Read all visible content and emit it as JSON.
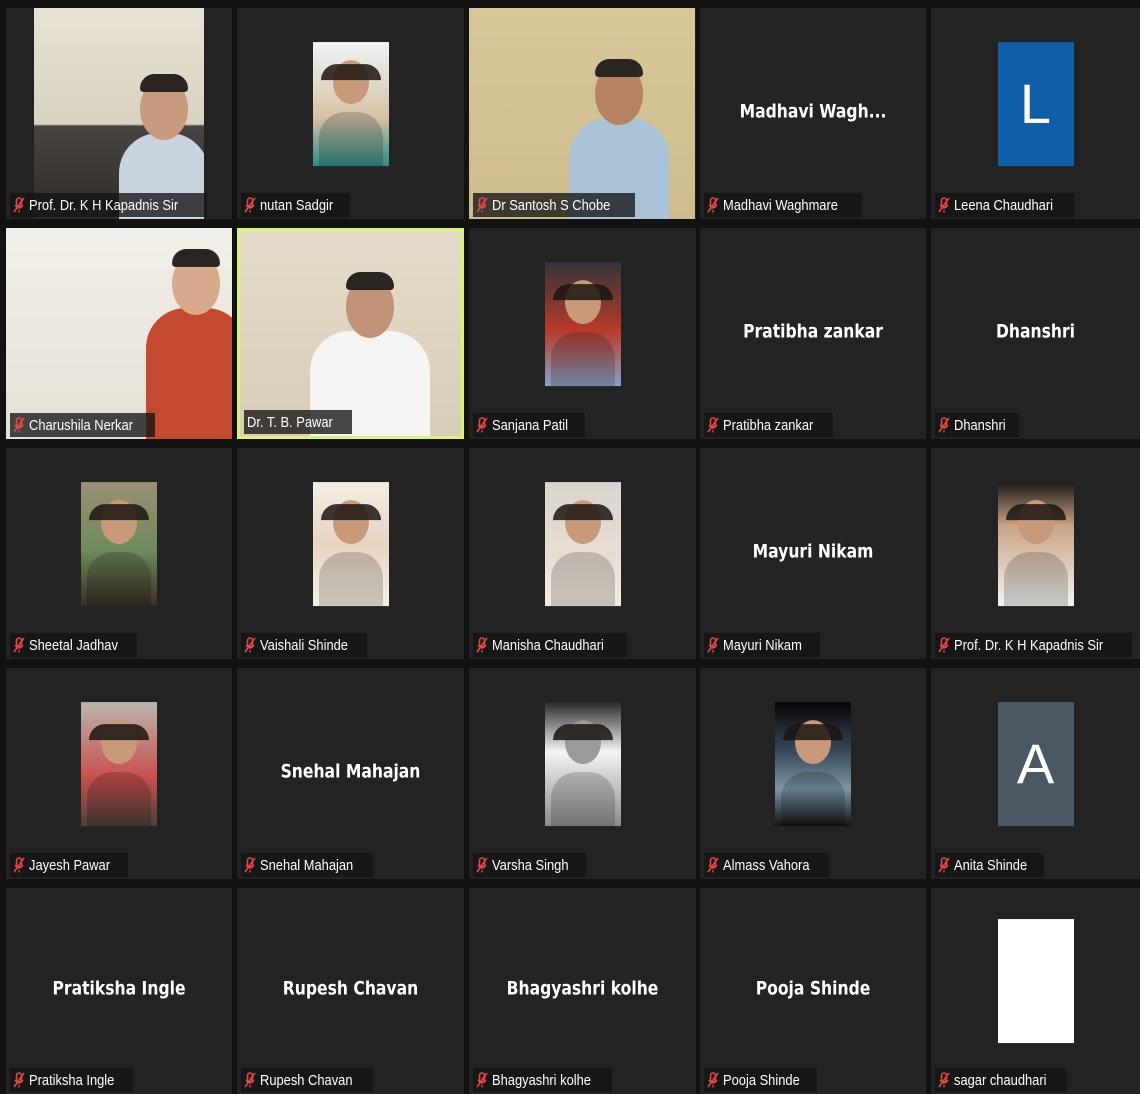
{
  "participants": [
    {
      "name": "Prof. Dr. K H Kapadnis Sir",
      "kind": "video"
    },
    {
      "name": "nutan Sadgir",
      "kind": "photo"
    },
    {
      "name": "Dr Santosh S Chobe",
      "kind": "video"
    },
    {
      "name": "Madhavi Waghmare",
      "kind": "text",
      "display": "Madhavi  Wagh..."
    },
    {
      "name": "Leena Chaudhari",
      "kind": "avatar",
      "letter": "L",
      "color": "#0f5ea8"
    },
    {
      "name": "Charushila Nerkar",
      "kind": "video"
    },
    {
      "name": "Dr. T. B. Pawar",
      "kind": "video",
      "active": true
    },
    {
      "name": "Sanjana Patil",
      "kind": "photo"
    },
    {
      "name": "Pratibha zankar",
      "kind": "text",
      "display": "Pratibha zankar"
    },
    {
      "name": "Dhanshri",
      "kind": "text",
      "display": "Dhanshri"
    },
    {
      "name": "Sheetal Jadhav",
      "kind": "photo"
    },
    {
      "name": "Vaishali Shinde",
      "kind": "photo"
    },
    {
      "name": "Manisha Chaudhari",
      "kind": "photo"
    },
    {
      "name": "Mayuri Nikam",
      "kind": "text",
      "display": "Mayuri Nikam"
    },
    {
      "name": "Prof. Dr. K H Kapadnis Sir",
      "kind": "photo"
    },
    {
      "name": "Jayesh Pawar",
      "kind": "photo"
    },
    {
      "name": "Snehal Mahajan",
      "kind": "text",
      "display": "Snehal Mahajan"
    },
    {
      "name": "Varsha Singh",
      "kind": "photo"
    },
    {
      "name": "Almass Vahora",
      "kind": "photo"
    },
    {
      "name": "Anita Shinde",
      "kind": "avatar",
      "letter": "A",
      "color": "#4a5863"
    },
    {
      "name": "Pratiksha Ingle",
      "kind": "text",
      "display": "Pratiksha Ingle"
    },
    {
      "name": "Rupesh Chavan",
      "kind": "text",
      "display": "Rupesh Chavan"
    },
    {
      "name": "Bhagyashri kolhe",
      "kind": "text",
      "display": "Bhagyashri kolhe"
    },
    {
      "name": "Pooja Shinde",
      "kind": "text",
      "display": "Pooja Shinde"
    },
    {
      "name": "sagar chaudhari",
      "kind": "avatar",
      "letter": "",
      "color": "#ffffff"
    }
  ],
  "colors": {
    "background": "#121212",
    "tile": "#232323",
    "active_border": "#d9f27a",
    "mute_icon": "#e04848"
  }
}
